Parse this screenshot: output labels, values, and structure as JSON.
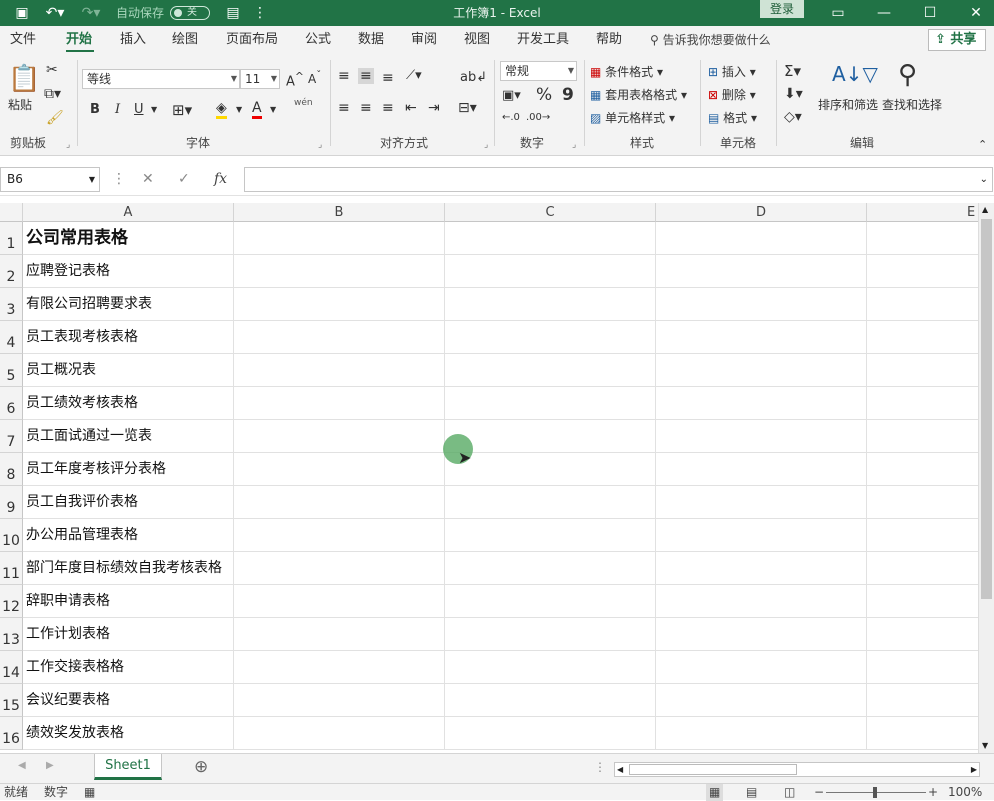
{
  "titlebar": {
    "autosave_label": "自动保存",
    "autosave_state": "关",
    "window_title": "工作簿1  -  Excel",
    "login_label": "登录"
  },
  "menu": {
    "items": [
      "文件",
      "开始",
      "插入",
      "绘图",
      "页面布局",
      "公式",
      "数据",
      "审阅",
      "视图",
      "开发工具",
      "帮助"
    ],
    "tell_me": "告诉我你想要做什么",
    "share": "共享"
  },
  "ribbon": {
    "clipboard": {
      "paste": "粘贴",
      "label": "剪贴板"
    },
    "font": {
      "name": "等线",
      "size": "11",
      "label": "字体",
      "bold": "B",
      "italic": "I",
      "underline": "U",
      "phonetic": "wén"
    },
    "alignment": {
      "label": "对齐方式"
    },
    "number": {
      "format": "常规",
      "percent": "%",
      "comma": "9",
      "label": "数字"
    },
    "styles": {
      "conditional": "条件格式",
      "table": "套用表格格式",
      "cell": "单元格样式",
      "label": "样式"
    },
    "cells": {
      "insert": "插入",
      "delete": "删除",
      "format": "格式",
      "label": "单元格"
    },
    "editing": {
      "sort": "排序和筛选",
      "find": "查找和选择",
      "label": "编辑"
    }
  },
  "formula_bar": {
    "name_box": "B6",
    "content": ""
  },
  "columns": [
    "A",
    "B",
    "C",
    "D",
    "E"
  ],
  "rows": [
    {
      "num": "1",
      "a": "公司常用表格"
    },
    {
      "num": "2",
      "a": "应聘登记表格"
    },
    {
      "num": "3",
      "a": "有限公司招聘要求表"
    },
    {
      "num": "4",
      "a": "员工表现考核表格"
    },
    {
      "num": "5",
      "a": "员工概况表"
    },
    {
      "num": "6",
      "a": "员工绩效考核表格"
    },
    {
      "num": "7",
      "a": "员工面试通过一览表"
    },
    {
      "num": "8",
      "a": "员工年度考核评分表格"
    },
    {
      "num": "9",
      "a": "员工自我评价表格"
    },
    {
      "num": "10",
      "a": "办公用品管理表格"
    },
    {
      "num": "11",
      "a": "部门年度目标绩效自我考核表格"
    },
    {
      "num": "12",
      "a": "辞职申请表格"
    },
    {
      "num": "13",
      "a": "工作计划表格"
    },
    {
      "num": "14",
      "a": "工作交接表格格"
    },
    {
      "num": "15",
      "a": "会议纪要表格"
    },
    {
      "num": "16",
      "a": "绩效奖发放表格"
    }
  ],
  "sheets": [
    "Sheet1"
  ],
  "status": {
    "ready": "就绪",
    "numlock": "数字",
    "zoom": "100%"
  },
  "colors": {
    "accent": "#217346"
  }
}
